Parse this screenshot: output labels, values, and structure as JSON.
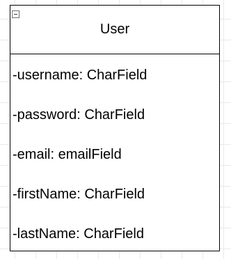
{
  "class_box": {
    "name": "User",
    "collapse_icon": "minus-square-icon",
    "attributes": [
      "-username: CharField",
      "-password: CharField",
      "-email: emailField",
      "-firstName: CharField",
      "-lastName: CharField"
    ]
  }
}
